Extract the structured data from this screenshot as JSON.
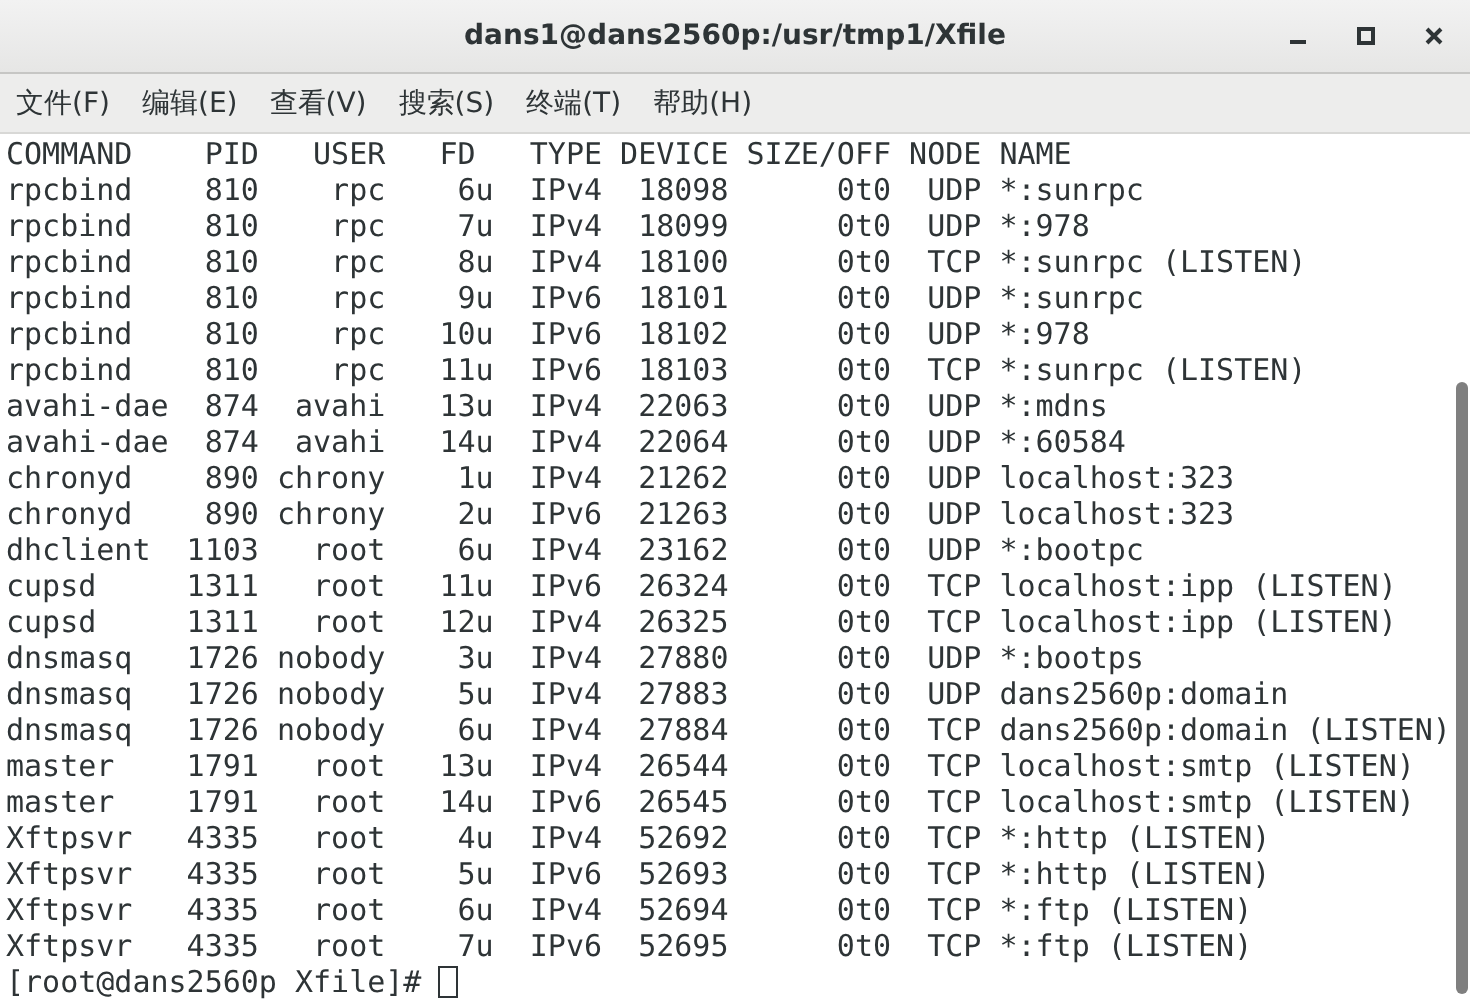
{
  "window": {
    "title": "dans1@dans2560p:/usr/tmp1/Xfile"
  },
  "menu": [
    "文件(F)",
    "编辑(E)",
    "查看(V)",
    "搜索(S)",
    "终端(T)",
    "帮助(H)"
  ],
  "terminal": {
    "lines": [
      "COMMAND    PID   USER   FD   TYPE DEVICE SIZE/OFF NODE NAME",
      "rpcbind    810    rpc    6u  IPv4  18098      0t0  UDP *:sunrpc",
      "rpcbind    810    rpc    7u  IPv4  18099      0t0  UDP *:978",
      "rpcbind    810    rpc    8u  IPv4  18100      0t0  TCP *:sunrpc (LISTEN)",
      "rpcbind    810    rpc    9u  IPv6  18101      0t0  UDP *:sunrpc",
      "rpcbind    810    rpc   10u  IPv6  18102      0t0  UDP *:978",
      "rpcbind    810    rpc   11u  IPv6  18103      0t0  TCP *:sunrpc (LISTEN)",
      "avahi-dae  874  avahi   13u  IPv4  22063      0t0  UDP *:mdns",
      "avahi-dae  874  avahi   14u  IPv4  22064      0t0  UDP *:60584",
      "chronyd    890 chrony    1u  IPv4  21262      0t0  UDP localhost:323",
      "chronyd    890 chrony    2u  IPv6  21263      0t0  UDP localhost:323",
      "dhclient  1103   root    6u  IPv4  23162      0t0  UDP *:bootpc",
      "cupsd     1311   root   11u  IPv6  26324      0t0  TCP localhost:ipp (LISTEN)",
      "cupsd     1311   root   12u  IPv4  26325      0t0  TCP localhost:ipp (LISTEN)",
      "dnsmasq   1726 nobody    3u  IPv4  27880      0t0  UDP *:bootps",
      "dnsmasq   1726 nobody    5u  IPv4  27883      0t0  UDP dans2560p:domain",
      "dnsmasq   1726 nobody    6u  IPv4  27884      0t0  TCP dans2560p:domain (LISTEN)",
      "master    1791   root   13u  IPv4  26544      0t0  TCP localhost:smtp (LISTEN)",
      "master    1791   root   14u  IPv6  26545      0t0  TCP localhost:smtp (LISTEN)",
      "Xftpsvr   4335   root    4u  IPv4  52692      0t0  TCP *:http (LISTEN)",
      "Xftpsvr   4335   root    5u  IPv6  52693      0t0  TCP *:http (LISTEN)",
      "Xftpsvr   4335   root    6u  IPv4  52694      0t0  TCP *:ftp (LISTEN)",
      "Xftpsvr   4335   root    7u  IPv6  52695      0t0  TCP *:ftp (LISTEN)"
    ],
    "prompt": "[root@dans2560p Xfile]#"
  }
}
